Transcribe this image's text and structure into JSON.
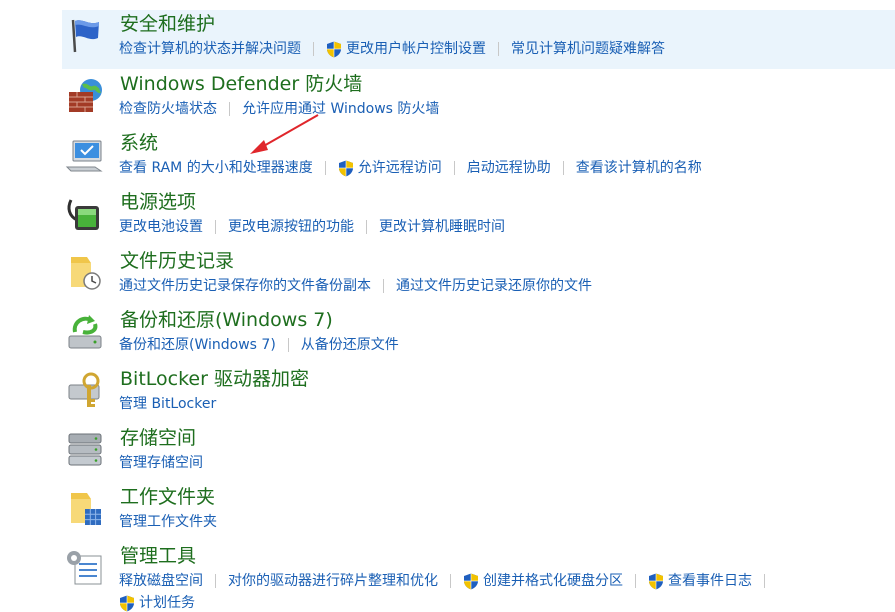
{
  "items": [
    {
      "title": "安全和维护",
      "links": [
        "检查计算机的状态并解决问题",
        "更改用户帐户控制设置",
        "常见计算机问题疑难解答"
      ]
    },
    {
      "title": "Windows Defender 防火墙",
      "links": [
        "检查防火墙状态",
        "允许应用通过 Windows 防火墙"
      ]
    },
    {
      "title": "系统",
      "links": [
        "查看 RAM 的大小和处理器速度",
        "允许远程访问",
        "启动远程协助",
        "查看该计算机的名称"
      ]
    },
    {
      "title": "电源选项",
      "links": [
        "更改电池设置",
        "更改电源按钮的功能",
        "更改计算机睡眠时间"
      ]
    },
    {
      "title": "文件历史记录",
      "links": [
        "通过文件历史记录保存你的文件备份副本",
        "通过文件历史记录还原你的文件"
      ]
    },
    {
      "title": "备份和还原(Windows 7)",
      "links": [
        "备份和还原(Windows 7)",
        "从备份还原文件"
      ]
    },
    {
      "title": "BitLocker 驱动器加密",
      "links": [
        "管理 BitLocker"
      ]
    },
    {
      "title": "存储空间",
      "links": [
        "管理存储空间"
      ]
    },
    {
      "title": "工作文件夹",
      "links": [
        "管理工作文件夹"
      ]
    },
    {
      "title": "管理工具",
      "links": [
        "释放磁盘空间",
        "对你的驱动器进行碎片整理和优化",
        "创建并格式化硬盘分区",
        "查看事件日志",
        "计划任务"
      ]
    }
  ],
  "colors": {
    "title": "#1e6e1e",
    "link": "#1a5fb4",
    "highlight": "#eaf4fc",
    "annotation_arrow": "#e0262b"
  },
  "icons": [
    "security-maintenance-flag-icon",
    "firewall-brick-globe-icon",
    "system-monitor-icon",
    "power-battery-icon",
    "file-history-folder-clock-icon",
    "backup-restore-drive-icon",
    "bitlocker-drive-key-icon",
    "storage-spaces-drives-icon",
    "work-folders-icon",
    "admin-tools-icon",
    "uac-shield-icon"
  ]
}
